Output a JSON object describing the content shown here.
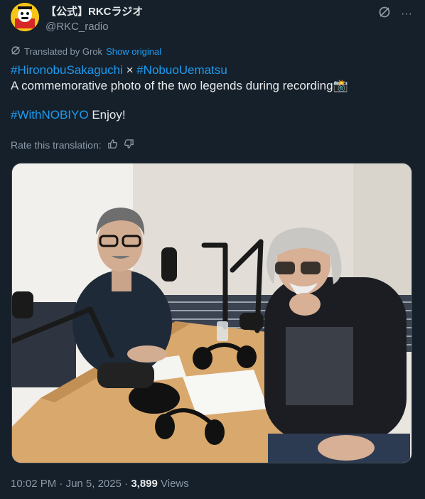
{
  "author": {
    "display_name": "【公式】RKCラジオ",
    "handle": "@RKC_radio",
    "avatar_icon": "mascot-avatar"
  },
  "top_actions": {
    "grok_icon": "grok-icon",
    "more_icon": "more-icon",
    "more_glyph": "···"
  },
  "translation": {
    "label": "Translated by Grok",
    "show_original": "Show original"
  },
  "tweet": {
    "tag1": "#HironobuSakaguchi",
    "separator": " × ",
    "tag2": "#NobuoUematsu",
    "line2": "A commemorative photo of the two legends during recording",
    "line2_emoji": "📸",
    "tag3": "#WithNOBIYO",
    "line3_text": " Enjoy!"
  },
  "rate": {
    "label": "Rate this translation:"
  },
  "meta": {
    "time": "10:02 PM",
    "dot1": " · ",
    "date": "Jun 5, 2025",
    "dot2": " · ",
    "views_count": "3,899",
    "views_label": " Views"
  },
  "colors": {
    "background": "#15202b",
    "link": "#1d9bf0",
    "secondary": "#8b98a5",
    "text": "#e7e9ea"
  }
}
